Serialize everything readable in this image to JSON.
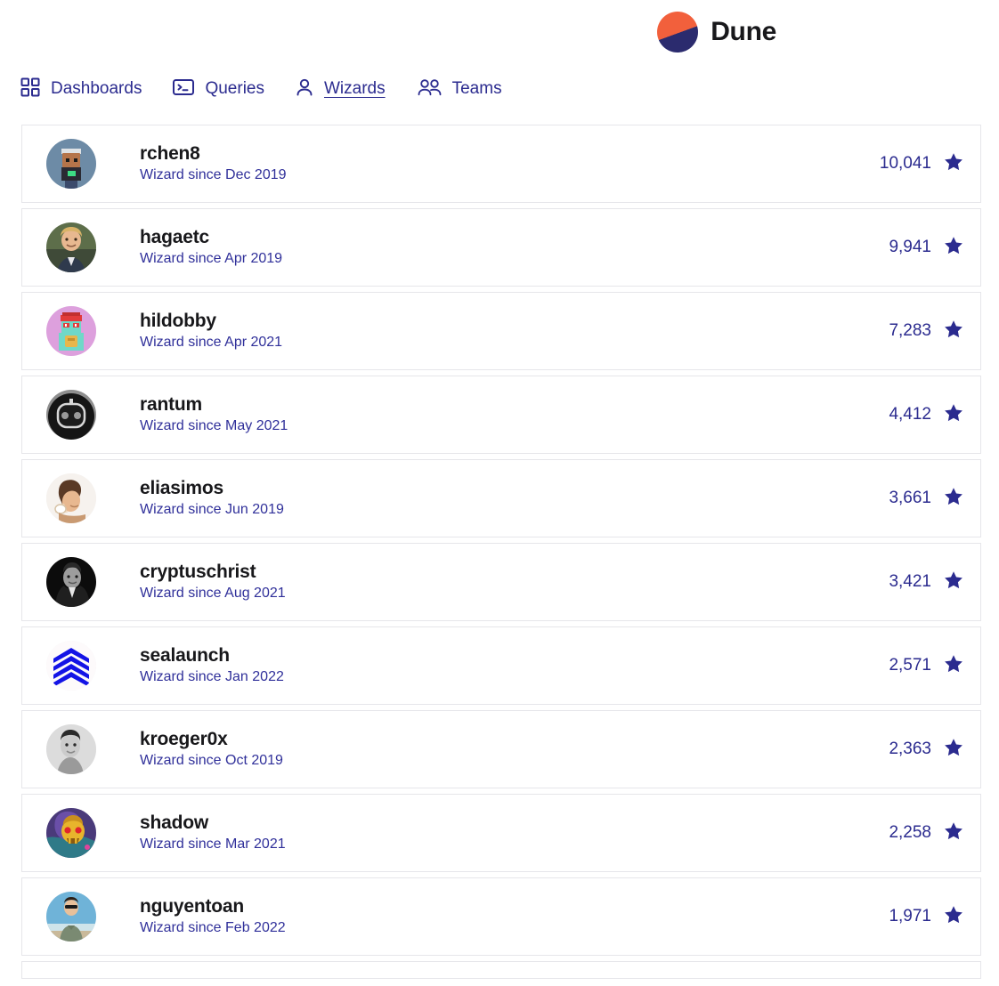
{
  "brand": {
    "name": "Dune",
    "logo_icon": "dune-logo-icon",
    "logo_top_color": "#f2603c",
    "logo_bottom_color": "#2b2b6e"
  },
  "theme": {
    "accent": "#2b2b8f",
    "text": "#18181b",
    "border": "#e6e6ea",
    "background": "#ffffff"
  },
  "nav": {
    "items": [
      {
        "label": "Dashboards",
        "icon": "grid-icon",
        "active": false
      },
      {
        "label": "Queries",
        "icon": "terminal-icon",
        "active": false
      },
      {
        "label": "Wizards",
        "icon": "user-icon",
        "active": true
      },
      {
        "label": "Teams",
        "icon": "users-icon",
        "active": false
      }
    ]
  },
  "wizards": [
    {
      "username": "rchen8",
      "since": "Wizard since Dec 2019",
      "stars": "10,041",
      "avatar": "pixel-character-avatar"
    },
    {
      "username": "hagaetc",
      "since": "Wizard since Apr 2019",
      "stars": "9,941",
      "avatar": "photo-portrait-avatar"
    },
    {
      "username": "hildobby",
      "since": "Wizard since Apr 2021",
      "stars": "7,283",
      "avatar": "nft-character-pink-avatar"
    },
    {
      "username": "rantum",
      "since": "Wizard since May 2021",
      "stars": "4,412",
      "avatar": "robot-avatar"
    },
    {
      "username": "eliasimos",
      "since": "Wizard since Jun 2019",
      "stars": "3,661",
      "avatar": "illustration-avatar"
    },
    {
      "username": "cryptuschrist",
      "since": "Wizard since Aug 2021",
      "stars": "3,421",
      "avatar": "bw-photo-avatar"
    },
    {
      "username": "sealaunch",
      "since": "Wizard since Jan 2022",
      "stars": "2,571",
      "avatar": "blue-chevron-logo-avatar"
    },
    {
      "username": "kroeger0x",
      "since": "Wizard since Oct 2019",
      "stars": "2,363",
      "avatar": "bw-photo-avatar"
    },
    {
      "username": "shadow",
      "since": "Wizard since Mar 2021",
      "stars": "2,258",
      "avatar": "skull-art-avatar"
    },
    {
      "username": "nguyentoan",
      "since": "Wizard since Feb 2022",
      "stars": "1,971",
      "avatar": "beach-photo-avatar"
    }
  ],
  "star_icon": "star-filled-icon"
}
